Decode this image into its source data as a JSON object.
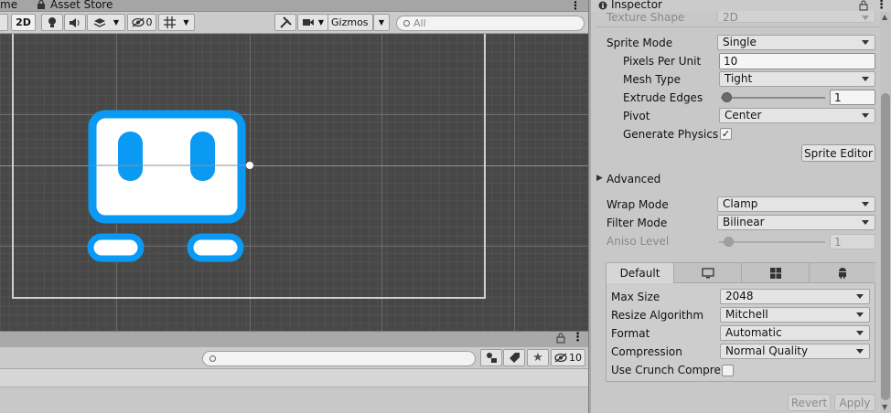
{
  "tabs": {
    "partial_tab": "me",
    "asset_store": "Asset Store"
  },
  "scene_toolbar": {
    "mode_2d": "2D",
    "hidden_count": "0",
    "gizmos": "Gizmos",
    "search_placeholder": "All"
  },
  "bottom_toolbar": {
    "hidden_count": "10"
  },
  "inspector": {
    "title": "Inspector",
    "texture_shape_label": "Texture Shape",
    "texture_shape_value": "2D",
    "sprite_mode_label": "Sprite Mode",
    "sprite_mode_value": "Single",
    "ppu_label": "Pixels Per Unit",
    "ppu_value": "10",
    "mesh_type_label": "Mesh Type",
    "mesh_type_value": "Tight",
    "extrude_label": "Extrude Edges",
    "extrude_value": "1",
    "pivot_label": "Pivot",
    "pivot_value": "Center",
    "gen_physics_label": "Generate Physics S",
    "gen_physics_checked": "✓",
    "sprite_editor": "Sprite Editor",
    "advanced": "Advanced",
    "wrap_mode_label": "Wrap Mode",
    "wrap_mode_value": "Clamp",
    "filter_mode_label": "Filter Mode",
    "filter_mode_value": "Bilinear",
    "aniso_label": "Aniso Level",
    "aniso_value": "1",
    "platform_default": "Default",
    "max_size_label": "Max Size",
    "max_size_value": "2048",
    "resize_label": "Resize Algorithm",
    "resize_value": "Mitchell",
    "format_label": "Format",
    "format_value": "Automatic",
    "compression_label": "Compression",
    "compression_value": "Normal Quality",
    "crunch_label": "Use Crunch Compres",
    "revert": "Revert",
    "apply": "Apply"
  },
  "colors": {
    "sprite_blue": "#0a9af4",
    "scene_bg": "#474747"
  }
}
